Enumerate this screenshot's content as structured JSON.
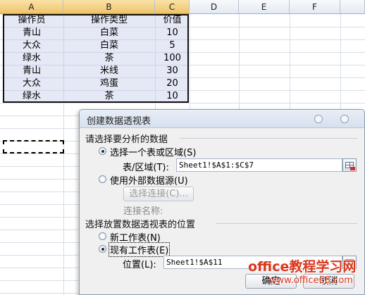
{
  "sheet": {
    "columns": [
      "A",
      "B",
      "C",
      "D",
      "E",
      "F"
    ],
    "header_row": [
      "操作员",
      "操作类型",
      "价值"
    ],
    "rows": [
      [
        "青山",
        "白菜",
        "10"
      ],
      [
        "大众",
        "白菜",
        "5"
      ],
      [
        "绿水",
        "茶",
        "100"
      ],
      [
        "青山",
        "米线",
        "30"
      ],
      [
        "大众",
        "鸡蛋",
        "20"
      ],
      [
        "绿水",
        "茶",
        "10"
      ]
    ]
  },
  "dialog": {
    "title": "创建数据透视表",
    "group1_title": "请选择要分析的数据",
    "option_table_range": "选择一个表或区域(S)",
    "table_range_label": "表/区域(T):",
    "table_range_value": "Sheet1!$A$1:$C$7",
    "option_external": "使用外部数据源(U)",
    "choose_connection_button": "选择连接(C)...",
    "connection_name_label": "连接名称:",
    "group2_title": "选择放置数据透视表的位置",
    "option_new_sheet": "新工作表(N)",
    "option_existing_sheet": "现有工作表(E)",
    "location_label": "位置(L):",
    "location_value": "Sheet1!$A$11",
    "ok_button": "确定",
    "cancel_button": "取消"
  },
  "watermark": {
    "line1": "office教程学习网",
    "line2": "www.office68.com"
  },
  "colors": {
    "selection_fill": "#c5cce8",
    "header_selected": "#f0c36a",
    "watermark": "#d9371c"
  }
}
